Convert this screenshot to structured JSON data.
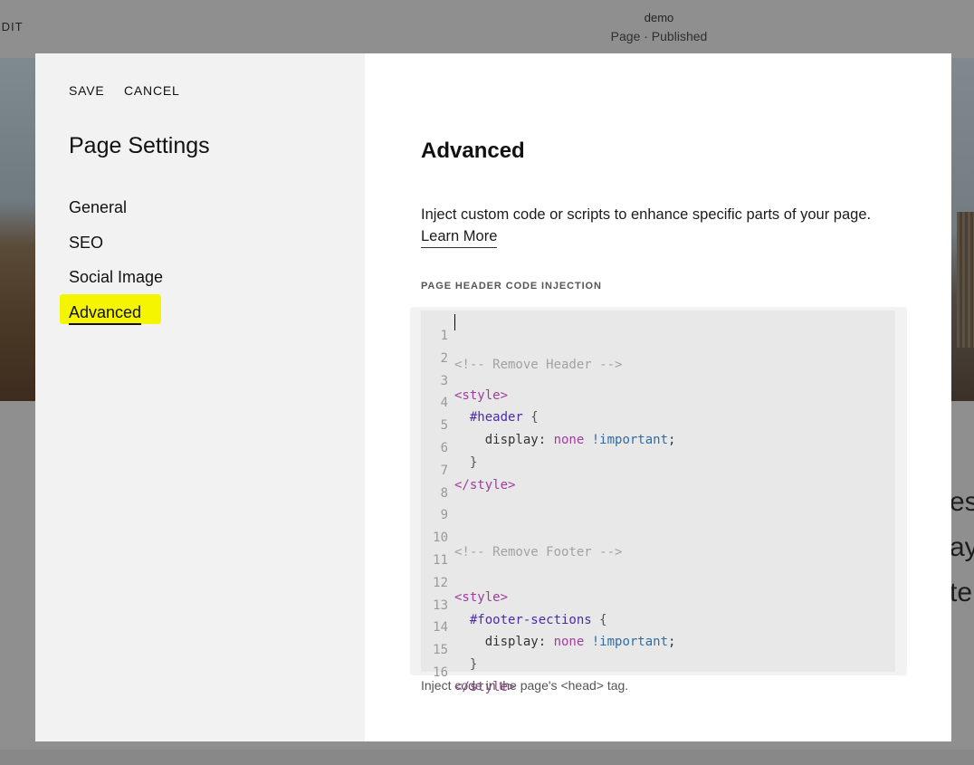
{
  "topbar": {
    "edit_label": "EDIT",
    "site_name": "demo",
    "status": "Page · Published"
  },
  "background_text": [
    "es",
    "ay",
    "te"
  ],
  "modal": {
    "save_label": "SAVE",
    "cancel_label": "CANCEL",
    "title": "Page Settings",
    "nav": [
      "General",
      "SEO",
      "Social Image",
      "Advanced"
    ],
    "active_nav": "Advanced"
  },
  "content": {
    "title": "Advanced",
    "description": "Inject custom code or scripts to enhance specific parts of your page.",
    "learn_more": "Learn More",
    "section_label": "PAGE HEADER CODE INJECTION",
    "helper": "Inject code in the page's <head> tag."
  },
  "code_editor": {
    "line_numbers": [
      "1",
      "2",
      "3",
      "4",
      "5",
      "6",
      "7",
      "8",
      "9",
      "10",
      "11",
      "12",
      "13",
      "14",
      "15",
      "16"
    ],
    "lines": [
      "<!-- Remove Header -->",
      "",
      "<style>",
      "  #header {",
      "    display: none !important;",
      "  }",
      "</style>",
      "",
      "",
      "<!-- Remove Footer -->",
      "",
      "<style>",
      "  #footer-sections {",
      "    display: none !important;",
      "  }",
      "</style>"
    ]
  },
  "colors": {
    "highlight": "#f5f500",
    "sidebar_bg": "#f2f2f2",
    "overlay": "#8f8f8f",
    "editor_bg": "#e8e8e8"
  }
}
